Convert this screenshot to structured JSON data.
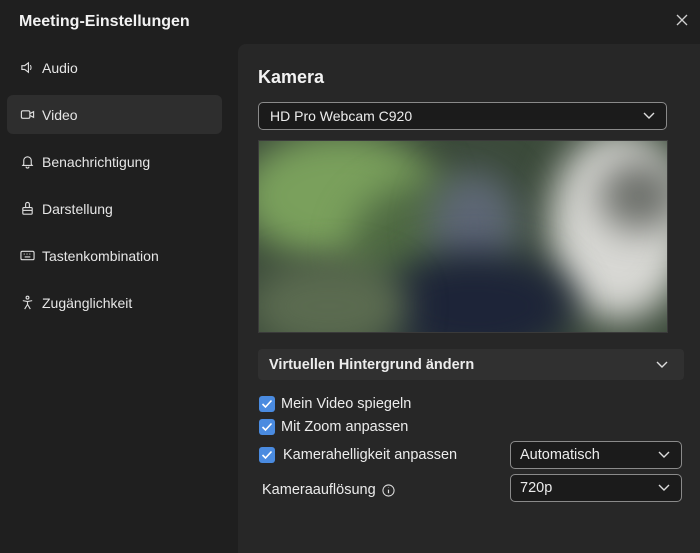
{
  "window": {
    "title": "Meeting-Einstellungen"
  },
  "sidebar": {
    "items": [
      {
        "label": "Audio",
        "icon": "speaker-icon",
        "active": false
      },
      {
        "label": "Video",
        "icon": "camera-icon",
        "active": true
      },
      {
        "label": "Benachrichtigung",
        "icon": "bell-icon",
        "active": false
      },
      {
        "label": "Darstellung",
        "icon": "paint-icon",
        "active": false
      },
      {
        "label": "Tastenkombination",
        "icon": "keyboard-icon",
        "active": false
      },
      {
        "label": "Zugänglichkeit",
        "icon": "accessibility-icon",
        "active": false
      }
    ]
  },
  "main": {
    "title": "Kamera",
    "camera_device": "HD Pro Webcam C920",
    "background_label": "Virtuellen Hintergrund ändern",
    "mirror_video": {
      "label": "Mein Video spiegeln",
      "checked": true
    },
    "zoom_adjust": {
      "label": "Mit Zoom anpassen",
      "checked": true
    },
    "brightness": {
      "label": "Kamerahelligkeit anpassen",
      "checked": true,
      "value": "Automatisch"
    },
    "resolution": {
      "label": "Kameraauflösung",
      "value": "720p"
    }
  },
  "colors": {
    "accent": "#4a8be0",
    "panel": "#272727",
    "background": "#1f1f1f"
  }
}
